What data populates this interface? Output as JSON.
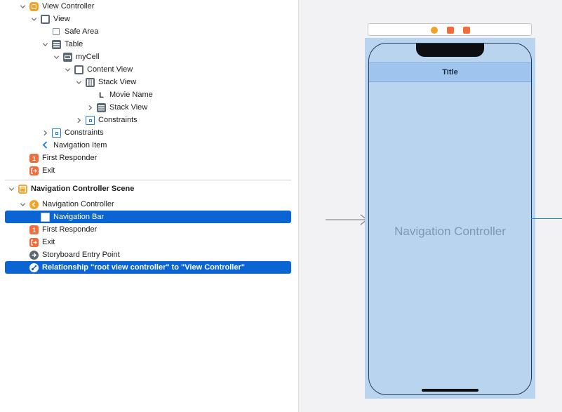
{
  "outline": {
    "items": [
      {
        "label": "View Controller",
        "icon": "view-controller-icon",
        "disclosure": "down"
      },
      {
        "label": "View",
        "icon": "view-icon",
        "disclosure": "down"
      },
      {
        "label": "Safe Area",
        "icon": "safe-area-icon",
        "disclosure": "none"
      },
      {
        "label": "Table",
        "icon": "table-icon",
        "disclosure": "down"
      },
      {
        "label": "myCell",
        "icon": "table-cell-icon",
        "disclosure": "down"
      },
      {
        "label": "Content View",
        "icon": "view-icon",
        "disclosure": "down"
      },
      {
        "label": "Stack View",
        "icon": "stack-view-icon",
        "disclosure": "down"
      },
      {
        "label": "Movie Name",
        "icon": "label-icon",
        "disclosure": "none"
      },
      {
        "label": "Stack View",
        "icon": "stack-view-icon",
        "disclosure": "right"
      },
      {
        "label": "Constraints",
        "icon": "constraints-icon",
        "disclosure": "right"
      },
      {
        "label": "Constraints",
        "icon": "constraints-icon",
        "disclosure": "right"
      },
      {
        "label": "Navigation Item",
        "icon": "navigation-item-icon",
        "disclosure": "none"
      },
      {
        "label": "First Responder",
        "icon": "first-responder-icon",
        "disclosure": "none"
      },
      {
        "label": "Exit",
        "icon": "exit-icon",
        "disclosure": "none"
      },
      {
        "label": "Navigation Controller Scene",
        "icon": "scene-icon",
        "disclosure": "down"
      },
      {
        "label": "Navigation Controller",
        "icon": "navigation-controller-icon",
        "disclosure": "down"
      },
      {
        "label": "Navigation Bar",
        "icon": "navigation-bar-icon",
        "disclosure": "none"
      },
      {
        "label": "First Responder",
        "icon": "first-responder-icon",
        "disclosure": "none"
      },
      {
        "label": "Exit",
        "icon": "exit-icon",
        "disclosure": "none"
      },
      {
        "label": "Storyboard Entry Point",
        "icon": "entry-point-icon",
        "disclosure": "none"
      },
      {
        "label": "Relationship \"root view controller\" to \"View Controller\"",
        "icon": "relationship-icon",
        "disclosure": "none"
      }
    ]
  },
  "canvas": {
    "nav_title": "Title",
    "controller_title": "Navigation Controller"
  },
  "colors": {
    "selection": "#0a64d4",
    "scene_fill": "#b9d4ef",
    "navbar_fill": "#9fc5ee",
    "accent_orange": "#f4a128",
    "relationship_line": "#1a7fd8"
  }
}
